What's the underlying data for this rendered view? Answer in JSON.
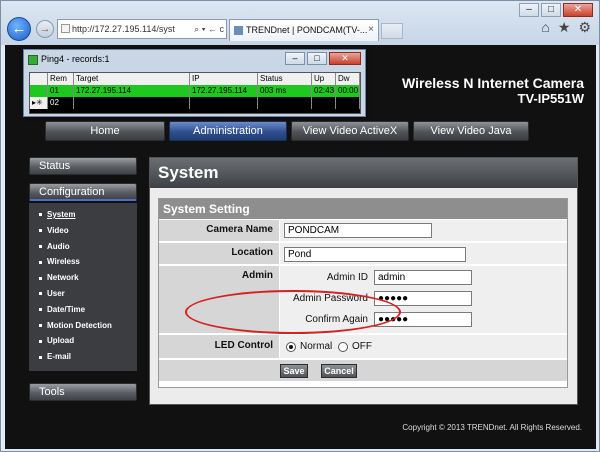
{
  "browser": {
    "address": "http://172.27.195.114/syst",
    "address_tools": "⌕ ▾ ← c",
    "tab_title": "TRENDnet | PONDCAM(TV-...",
    "tab_close": "×",
    "window_controls": {
      "minimize": "–",
      "maximize": "□",
      "close": "✕"
    },
    "back": "←",
    "forward": "→",
    "tool_icons": [
      "⌂",
      "★",
      "⚙"
    ]
  },
  "ping": {
    "title": "Ping4 - records:1",
    "controls": {
      "minimize": "–",
      "maximize": "□",
      "close": "✕"
    },
    "columns": [
      "",
      "Rem",
      "Target",
      "IP",
      "Status",
      "Up",
      "Dw"
    ],
    "rows": [
      {
        "marker": "",
        "rem": "01",
        "target": "172.27.195.114",
        "ip": "172.27.195.114",
        "status": "003 ms",
        "up": "02:43",
        "dw": "00:00"
      },
      {
        "marker": "▸✳",
        "rem": "02",
        "target": "",
        "ip": "",
        "status": "",
        "up": "",
        "dw": ""
      }
    ]
  },
  "header": {
    "line1": "Wireless N Internet Camera",
    "line2": "TV-IP551W"
  },
  "nav": {
    "home": "Home",
    "administration": "Administration",
    "view_video_activex": "View Video  ActiveX",
    "view_video_java": "View Video    Java"
  },
  "sidebar": {
    "status": "Status",
    "configuration": "Configuration",
    "items": [
      "System",
      "Video",
      "Audio",
      "Wireless",
      "Network",
      "User",
      "Date/Time",
      "Motion Detection",
      "Upload",
      "E-mail"
    ],
    "tools": "Tools"
  },
  "main": {
    "title": "System",
    "section": "System Setting",
    "camera_name_label": "Camera Name",
    "camera_name_value": "PONDCAM",
    "location_label": "Location",
    "location_value": "Pond",
    "admin_label": "Admin",
    "admin_id_label": "Admin ID",
    "admin_id_value": "admin",
    "admin_password_label": "Admin Password",
    "admin_password_value": "●●●●●",
    "confirm_label": "Confirm Again",
    "confirm_value": "●●●●●",
    "led_label": "LED Control",
    "led_normal": "Normal",
    "led_off": "OFF",
    "led_selected": "Normal",
    "save": "Save",
    "cancel": "Cancel"
  },
  "footer": {
    "copyright": "Copyright © 2013 TRENDnet.  All Rights Reserved."
  },
  "colors": {
    "ping_green": "#1ec81e",
    "highlight_oval": "#d32020",
    "active_nav": "#2e4f8f"
  }
}
